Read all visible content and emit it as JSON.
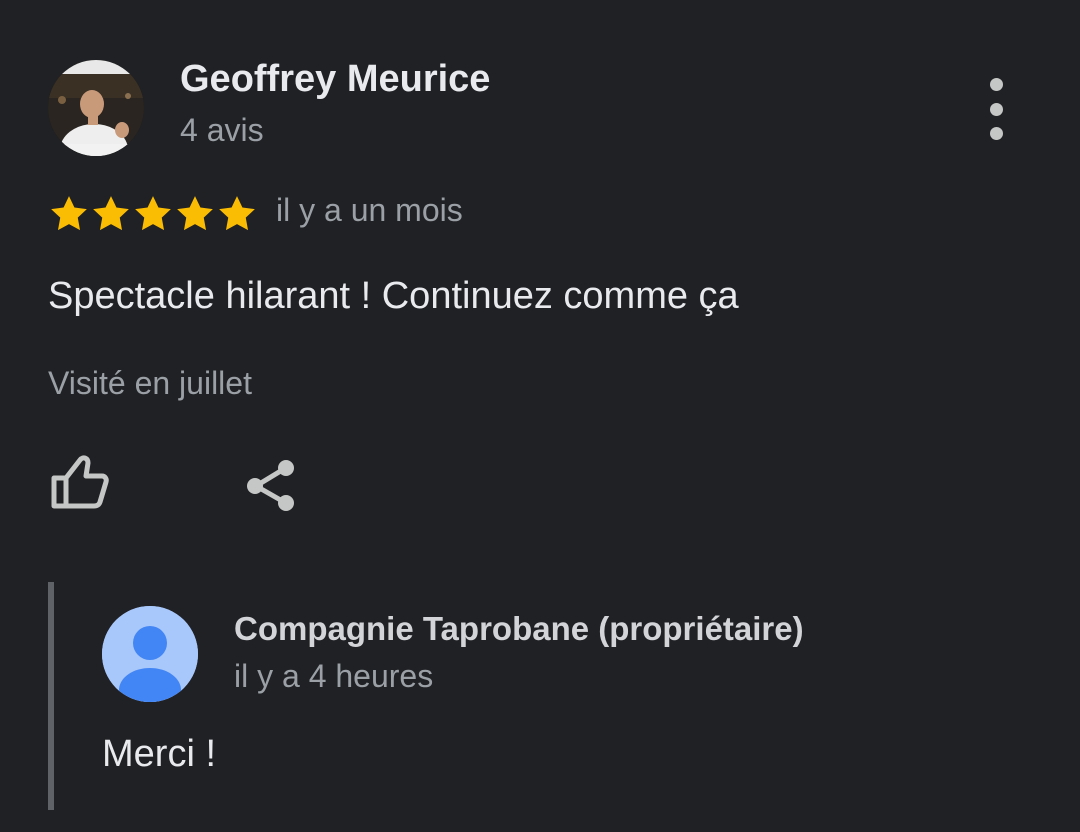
{
  "review": {
    "author_name": "Geoffrey Meurice",
    "author_review_count": "4 avis",
    "rating": 5,
    "rating_max": 5,
    "time": "il y a un mois",
    "text": "Spectacle hilarant ! Continuez comme ça",
    "visited": "Visité en juillet"
  },
  "actions": {
    "like_icon": "thumb-up-outline",
    "share_icon": "share",
    "more_icon": "more-vert"
  },
  "owner_reply": {
    "author_name": "Compagnie Taprobane (propriétaire)",
    "time": "il y a 4 heures",
    "text": "Merci !",
    "avatar_icon": "default-person"
  },
  "colors": {
    "background": "#202124",
    "star": "#fbbc04",
    "secondary_text": "#9aa0a6",
    "owner_avatar_bg": "#a8c7fa",
    "owner_avatar_fg": "#4285f4"
  }
}
